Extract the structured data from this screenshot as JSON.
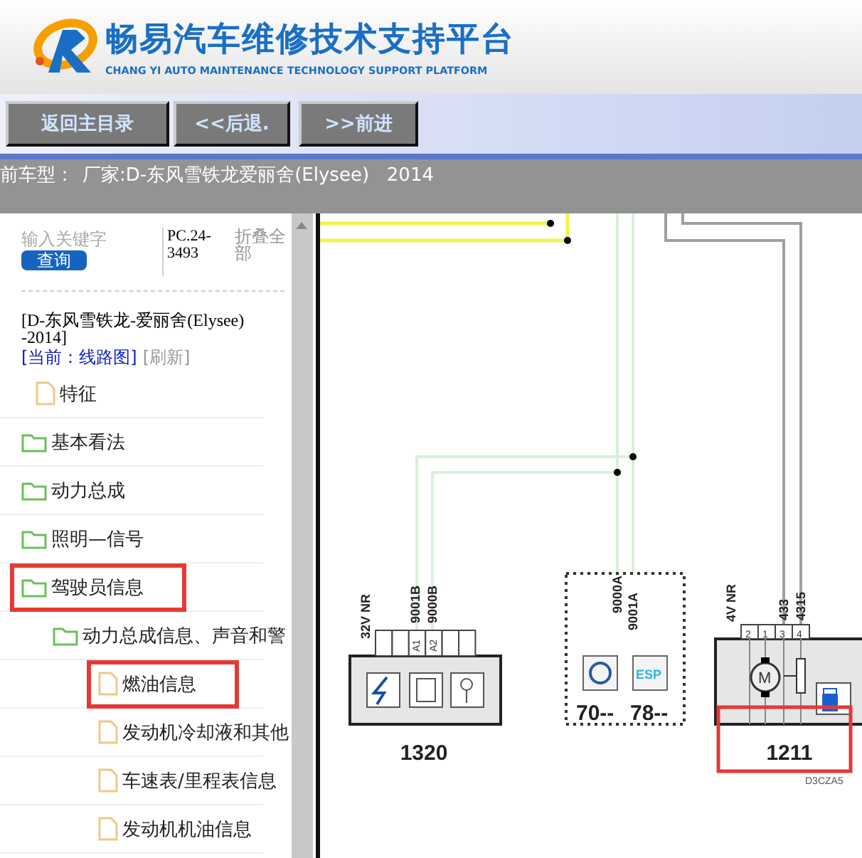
{
  "header": {
    "title": "畅易汽车维修技术支持平台",
    "subtitle": "CHANG YI AUTO MAINTENANCE TECHNOLOGY SUPPORT PLATFORM"
  },
  "nav_buttons": [
    "返回主目录",
    "<<后退.",
    ">>前进"
  ],
  "model_bar": {
    "label": "前车型：",
    "value": "厂家:D-东风雪铁龙爱丽舍(Elysee)   2014"
  },
  "sidebar": {
    "search": {
      "placeholder": "输入关键字",
      "button": "查询"
    },
    "code": "PC.24-3493",
    "collapse": "折叠全部",
    "vehicle": "[D-东风雪铁龙-爱丽舍(Elysee)    -2014]",
    "current": "[当前：线路图]",
    "refresh": "[刷新]",
    "tree": [
      {
        "label": "特征",
        "kind": "file",
        "marked": false
      },
      {
        "label": "基本看法",
        "kind": "folder",
        "marked": false
      },
      {
        "label": "动力总成",
        "kind": "folder",
        "marked": false
      },
      {
        "label": "照明—信号",
        "kind": "folder",
        "marked": false
      },
      {
        "label": "驾驶员信息",
        "kind": "folder",
        "marked": true,
        "children": [
          {
            "label": "动力总成信息、声音和警",
            "kind": "folder",
            "marked": false,
            "children": [
              {
                "label": "燃油信息",
                "kind": "file",
                "marked": true
              },
              {
                "label": "发动机冷却液和其他",
                "kind": "file",
                "marked": false
              },
              {
                "label": "车速表/里程表信息",
                "kind": "file",
                "marked": false
              },
              {
                "label": "发动机机油信息",
                "kind": "file",
                "marked": false
              }
            ]
          }
        ]
      }
    ]
  },
  "diagram": {
    "modules": [
      {
        "kind": "connector",
        "number": "1320",
        "type_label": "32V NR",
        "wire_labels": [
          "9001B",
          "9000B"
        ],
        "pin_labels": [
          "A1",
          "A2"
        ],
        "marked": false
      },
      {
        "kind": "group",
        "codes": [
          "70--",
          "78--"
        ],
        "wire_labels": [
          "9000A",
          "9001A"
        ],
        "icon_label": "ESP",
        "marked": false
      },
      {
        "kind": "connector",
        "number": "1211",
        "type_label": "4V NR",
        "wire_labels": [
          "433",
          "4315"
        ],
        "pin_labels": [
          "2",
          "1",
          "3",
          "4"
        ],
        "motor_label": "M",
        "marked": true
      }
    ],
    "drawing_code": "D3CZA5"
  }
}
